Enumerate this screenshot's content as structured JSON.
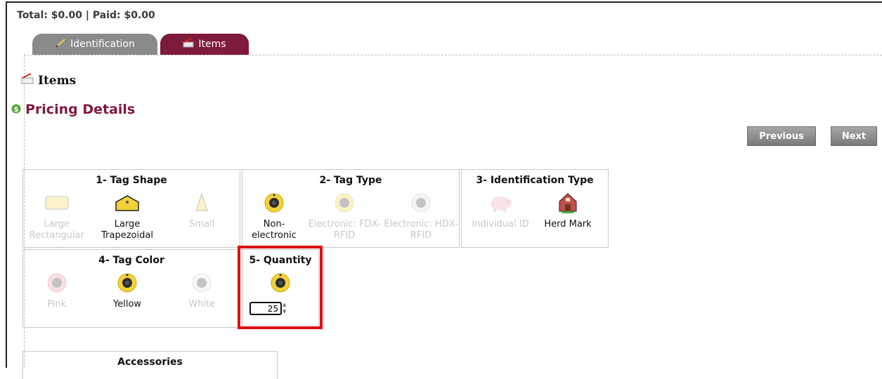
{
  "totals": "Total: $0.00 | Paid: $0.00",
  "tabs": [
    {
      "label": "Identification",
      "icon": "pencil-icon",
      "color": "#8a8a8a"
    },
    {
      "label": "Items",
      "icon": "cart-icon",
      "color": "#7e1a3c"
    }
  ],
  "section": {
    "title": "Items"
  },
  "pricing": {
    "title": "Pricing Details",
    "color": "#7e1a3c"
  },
  "nav": {
    "previous": "Previous",
    "next": "Next"
  },
  "tag_shape": {
    "title": "1- Tag Shape",
    "options": [
      {
        "label": "Large Rectangular",
        "selected": false
      },
      {
        "label": "Large Trapezoidal",
        "selected": true
      },
      {
        "label": "Small",
        "selected": false
      }
    ]
  },
  "tag_type": {
    "title": "2- Tag Type",
    "options": [
      {
        "label": "Non-electronic",
        "selected": true
      },
      {
        "label": "Electronic: FDX-RFID",
        "selected": false
      },
      {
        "label": "Electronic: HDX-RFID",
        "selected": false
      }
    ]
  },
  "identification_type": {
    "title": "3- Identification Type",
    "options": [
      {
        "label": "Individual ID",
        "selected": false
      },
      {
        "label": "Herd Mark",
        "selected": true
      }
    ]
  },
  "tag_color": {
    "title": "4- Tag Color",
    "options": [
      {
        "label": "Pink",
        "selected": false
      },
      {
        "label": "Yellow",
        "selected": true
      },
      {
        "label": "White",
        "selected": false
      }
    ]
  },
  "quantity": {
    "title": "5- Quantity",
    "value": "25"
  },
  "accessories": {
    "title": "Accessories"
  },
  "colors": {
    "accent": "#7e1a3c",
    "tag_yellow": "#f2d13a",
    "highlight": "#e01010"
  }
}
